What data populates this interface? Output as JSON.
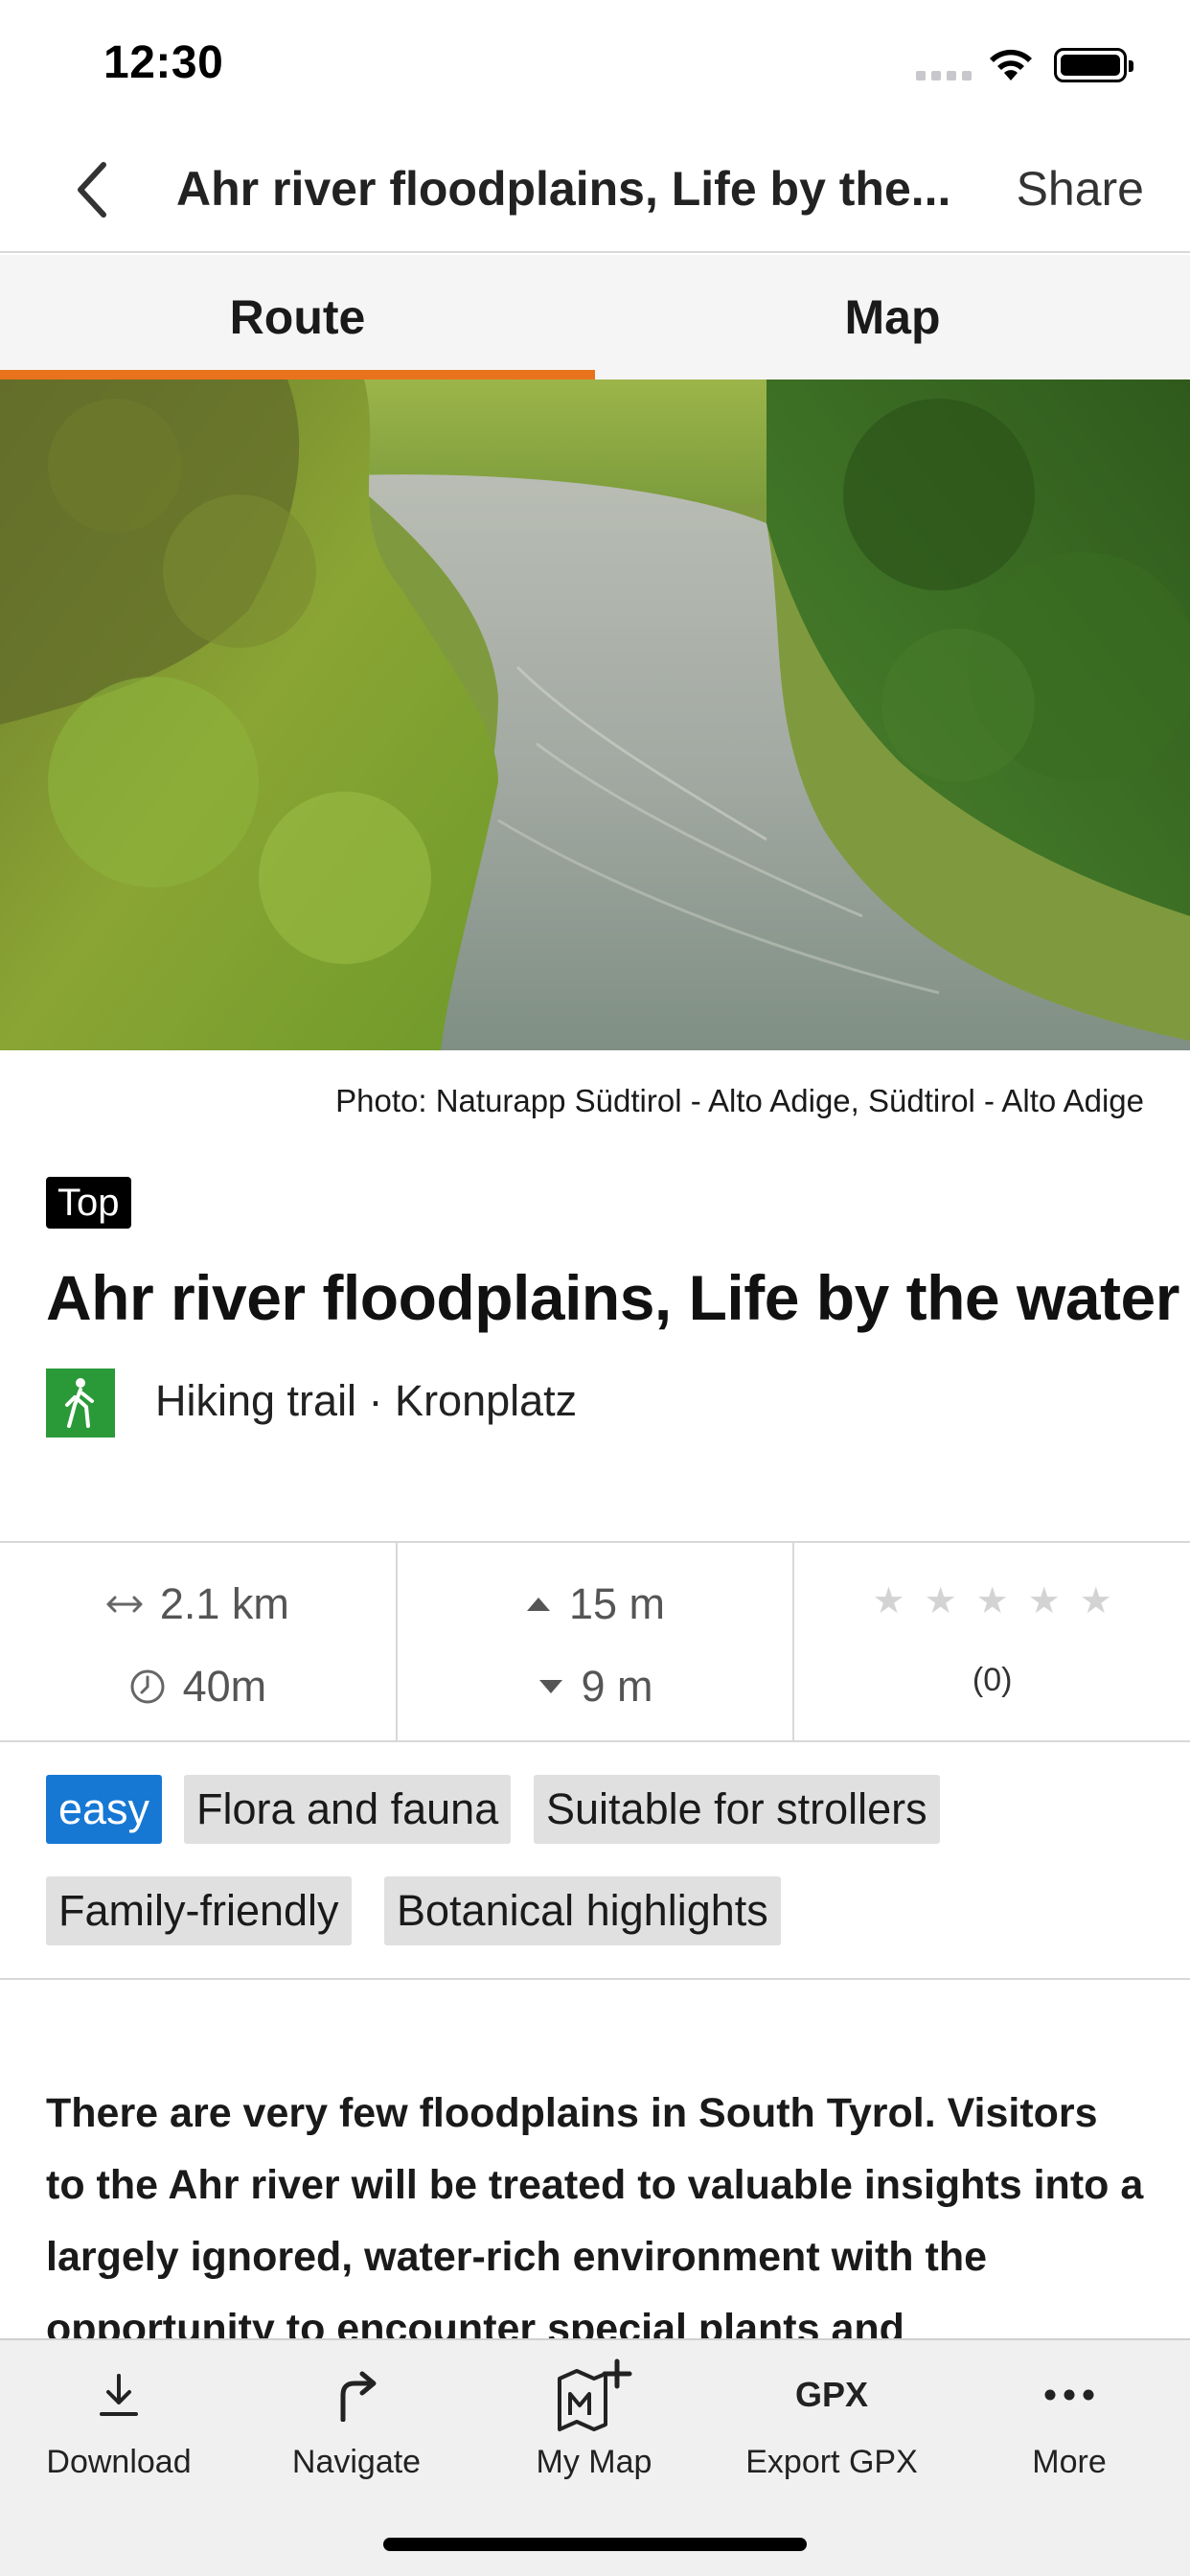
{
  "status_bar": {
    "time": "12:30"
  },
  "nav": {
    "title": "Ahr river floodplains, Life by the...",
    "share_label": "Share"
  },
  "tabs": [
    {
      "label": "Route",
      "active": true
    },
    {
      "label": "Map",
      "active": false
    }
  ],
  "hero": {
    "photo_caption": "Photo: Naturapp Südtirol - Alto Adige, Südtirol - Alto Adige"
  },
  "header": {
    "badge": "Top",
    "title": "Ahr river floodplains, Life by the water",
    "activity": "Hiking trail · Kronplatz",
    "activity_icon": "hiking-icon",
    "activity_color": "#2a9a38"
  },
  "stats": {
    "distance": "2.1 km",
    "duration": "40m",
    "ascent": "15 m",
    "descent": "9 m",
    "rating_stars": 0,
    "rating_count": "(0)"
  },
  "tags": {
    "difficulty": "easy",
    "difficulty_color": "#1778d4",
    "items": [
      "Flora and fauna",
      "Suitable for strollers",
      "Family-friendly",
      "Botanical highlights"
    ]
  },
  "description": "There are very few floodplains in South Tyrol. Visitors to the Ahr river will be treated to valuable insights into a largely ignored, water-rich environment with the opportunity to encounter special plants and",
  "toolbar": {
    "items": [
      {
        "label": "Download",
        "icon": "download-icon"
      },
      {
        "label": "Navigate",
        "icon": "navigate-icon"
      },
      {
        "label": "My Map",
        "icon": "my-map-icon"
      },
      {
        "label": "Export GPX",
        "icon": "gpx-icon",
        "icon_text": "GPX"
      },
      {
        "label": "More",
        "icon": "more-icon"
      }
    ]
  },
  "accent_color": "#e8731c"
}
